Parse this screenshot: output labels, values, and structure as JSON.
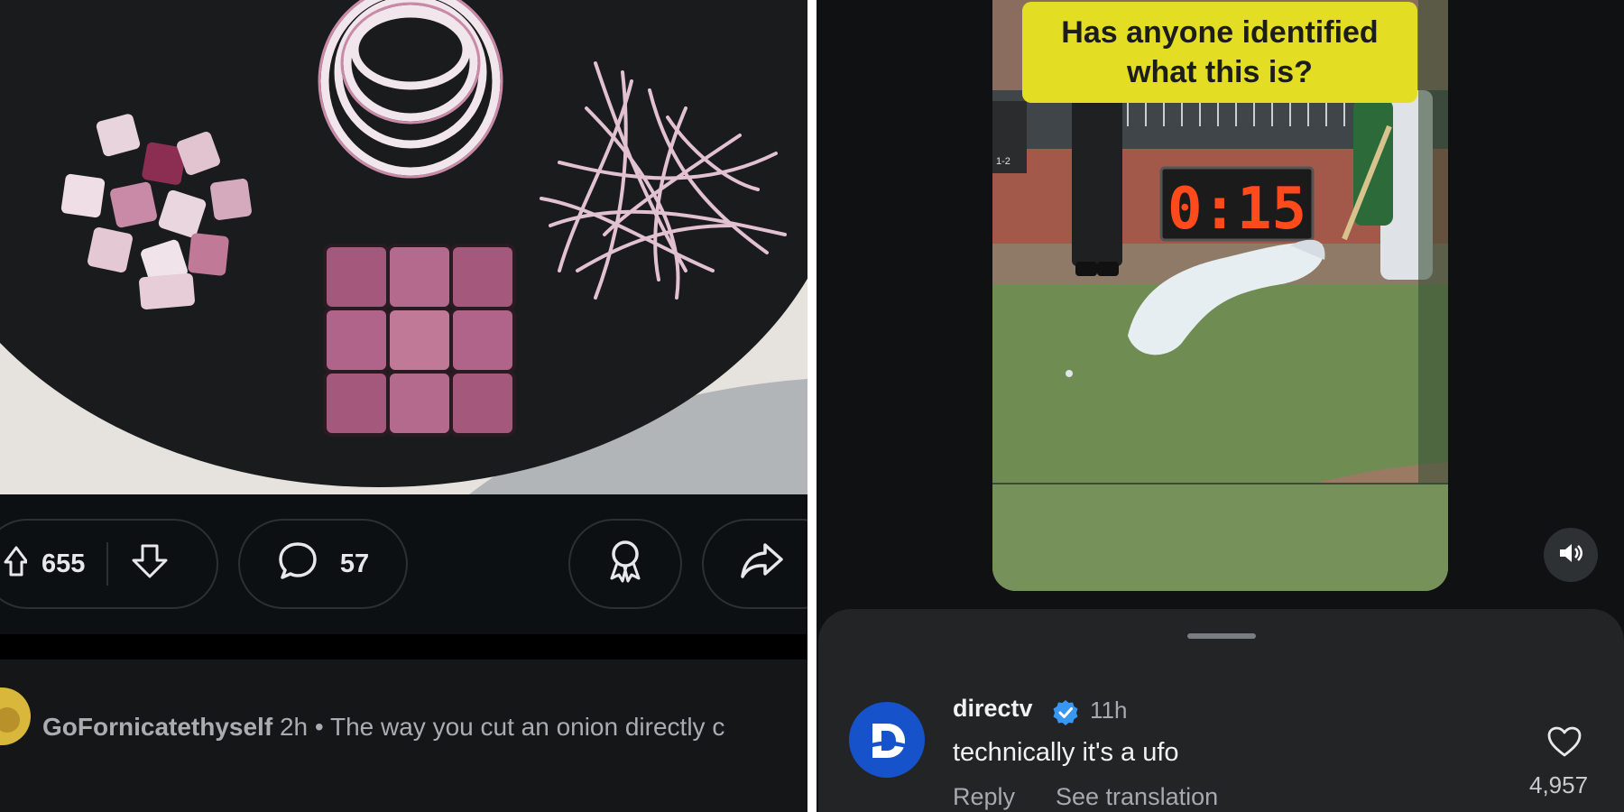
{
  "left_post": {
    "upvotes": "655",
    "comments": "57",
    "comment": {
      "username": "GoFornicatethyself",
      "time": "2h",
      "separator": "•",
      "text": "The way you cut an onion directly c"
    }
  },
  "right_post": {
    "video_caption": "Has anyone identified what this is?",
    "scoreboard_clock": "0:15",
    "scoreboard_small": "1-2",
    "comment": {
      "username": "directv",
      "verified": true,
      "time": "11h",
      "text": "technically it's a ufo",
      "reply_label": "Reply",
      "translate_label": "See translation",
      "likes": "4,957"
    }
  },
  "icons": [
    "upvote-icon",
    "downvote-icon",
    "comment-icon",
    "award-icon",
    "share-icon",
    "volume-icon",
    "verified-icon",
    "heart-icon"
  ],
  "colors": {
    "caption_bg": "#e3de23",
    "verified": "#3897f0",
    "avatar_bg": "#1652c9"
  }
}
